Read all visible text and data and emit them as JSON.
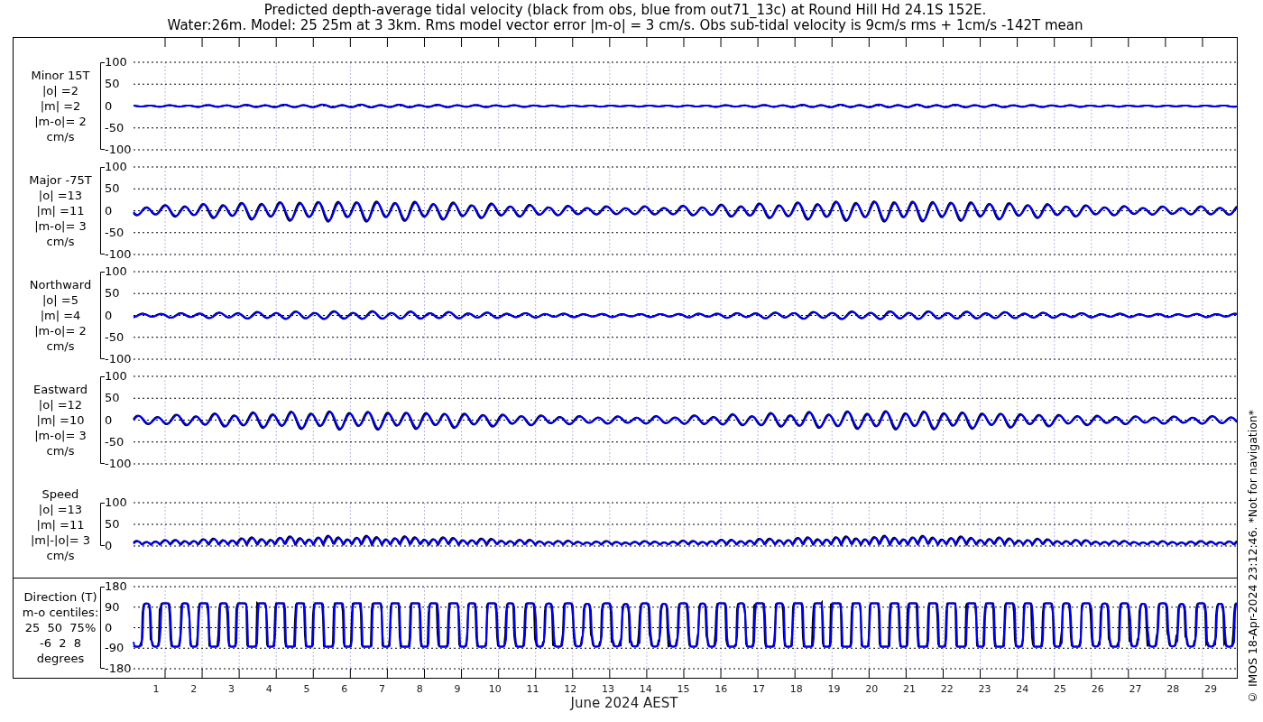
{
  "title": {
    "line_1": "Predicted depth-average tidal velocity (black from obs, blue from out71_13c) at Round Hill Hd 24.1S 152E.",
    "line_2": "Water:26m. Model: 25 25m at 3 3km. Rms model vector error |m-o| = 3 cm/s. Obs sub-tidal velocity is 9cm/s rms + 1cm/s -142T mean"
  },
  "panels": [
    {
      "kind": "velocity",
      "label": [
        "Minor 15T",
        "|o| =2",
        "|m| =2",
        "|m-o|= 2",
        "cm/s"
      ],
      "yticks": [
        "100",
        "50",
        "0",
        "-50",
        "-100"
      ]
    },
    {
      "kind": "velocity",
      "label": [
        "Major -75T",
        "|o| =13",
        "|m| =11",
        "|m-o|= 3",
        "cm/s"
      ],
      "yticks": [
        "100",
        "50",
        "0",
        "-50",
        "-100"
      ]
    },
    {
      "kind": "velocity",
      "label": [
        "Northward",
        "|o| =5",
        "|m| =4",
        "|m-o|= 2",
        "cm/s"
      ],
      "yticks": [
        "100",
        "50",
        "0",
        "-50",
        "-100"
      ]
    },
    {
      "kind": "velocity",
      "label": [
        "Eastward",
        "|o| =12",
        "|m| =10",
        "|m-o|= 3",
        "cm/s"
      ],
      "yticks": [
        "100",
        "50",
        "0",
        "-50",
        "-100"
      ]
    },
    {
      "kind": "speed",
      "label": [
        "Speed",
        "|o| =13",
        "|m| =11",
        "|m|-|o|= 3",
        "cm/s"
      ],
      "yticks": [
        "100",
        "50",
        "0"
      ]
    }
  ],
  "direction": {
    "label": [
      "Direction (T)",
      "m-o centiles:",
      "25  50  75%",
      "-6  2  8",
      "degrees"
    ],
    "yticks": [
      "180",
      "90",
      "0",
      "-90",
      "-180"
    ]
  },
  "x_axis": {
    "ticks": [
      "1",
      "2",
      "3",
      "4",
      "5",
      "6",
      "7",
      "8",
      "9",
      "10",
      "11",
      "12",
      "13",
      "14",
      "15",
      "16",
      "17",
      "18",
      "19",
      "20",
      "21",
      "22",
      "23",
      "24",
      "25",
      "26",
      "27",
      "28",
      "29"
    ],
    "label": "June 2024 AEST"
  },
  "credit": "© IMOS 18-Apr-2024 23:12:46. *Not for navigation*"
}
